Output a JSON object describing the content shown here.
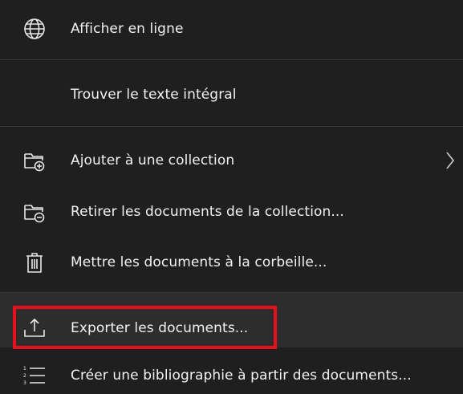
{
  "menu": {
    "items": [
      {
        "id": "view-online",
        "label": "Afficher en ligne",
        "icon": "globe-icon"
      },
      {
        "id": "find-full-text",
        "label": "Trouver le texte intégral",
        "icon": ""
      },
      {
        "id": "add-to-collection",
        "label": "Ajouter à une collection",
        "icon": "folder-add-icon",
        "submenu": true
      },
      {
        "id": "remove-from-collection",
        "label": "Retirer les documents de la collection...",
        "icon": "folder-remove-icon"
      },
      {
        "id": "move-to-trash",
        "label": "Mettre les documents à la corbeille...",
        "icon": "trash-icon"
      },
      {
        "id": "export-documents",
        "label": "Exporter les documents...",
        "icon": "export-icon",
        "highlighted": true
      },
      {
        "id": "create-bibliography",
        "label": "Créer une bibliographie à partir des documents...",
        "icon": "numbered-list-icon"
      }
    ]
  },
  "colors": {
    "background": "#1f1f1f",
    "highlight": "#2d2d2d",
    "separator": "#3a3a3a",
    "annotation": "#e8101c",
    "text": "#f2f2f2"
  }
}
